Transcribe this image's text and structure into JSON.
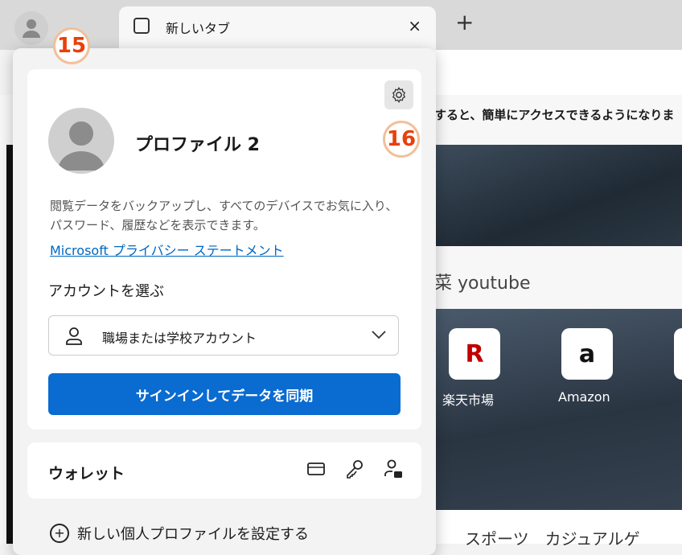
{
  "tab": {
    "title": "新しいタブ",
    "close": "×"
  },
  "newtab_button": "+",
  "ntp": {
    "banner_text": "すると、簡単にアクセスできるようになりま",
    "search_text": "菜 youtube",
    "tiles": [
      {
        "letter": "R",
        "label": "楽天市場",
        "color": "#bf0000"
      },
      {
        "letter": "a",
        "label": "Amazon",
        "color": "#111111"
      }
    ],
    "nav_text": "スポーツ　カジュアルゲ"
  },
  "flyout": {
    "profile_name": "プロファイル 2",
    "description": "閲覧データをバックアップし、すべてのデバイスでお気に入り、パスワード、履歴などを表示できます。",
    "privacy_link": "Microsoft プライバシー ステートメント",
    "account_label": "アカウントを選ぶ",
    "account_select_value": "職場または学校アカウント",
    "signin_button": "サインインしてデータを同期",
    "wallet_title": "ウォレット",
    "new_profile": "新しい個人プロファイルを設定する"
  },
  "badges": {
    "step15": "15",
    "step16": "16"
  },
  "colors": {
    "accent": "#0a6bd1",
    "badge": "#e8400c",
    "link": "#0067c0"
  }
}
